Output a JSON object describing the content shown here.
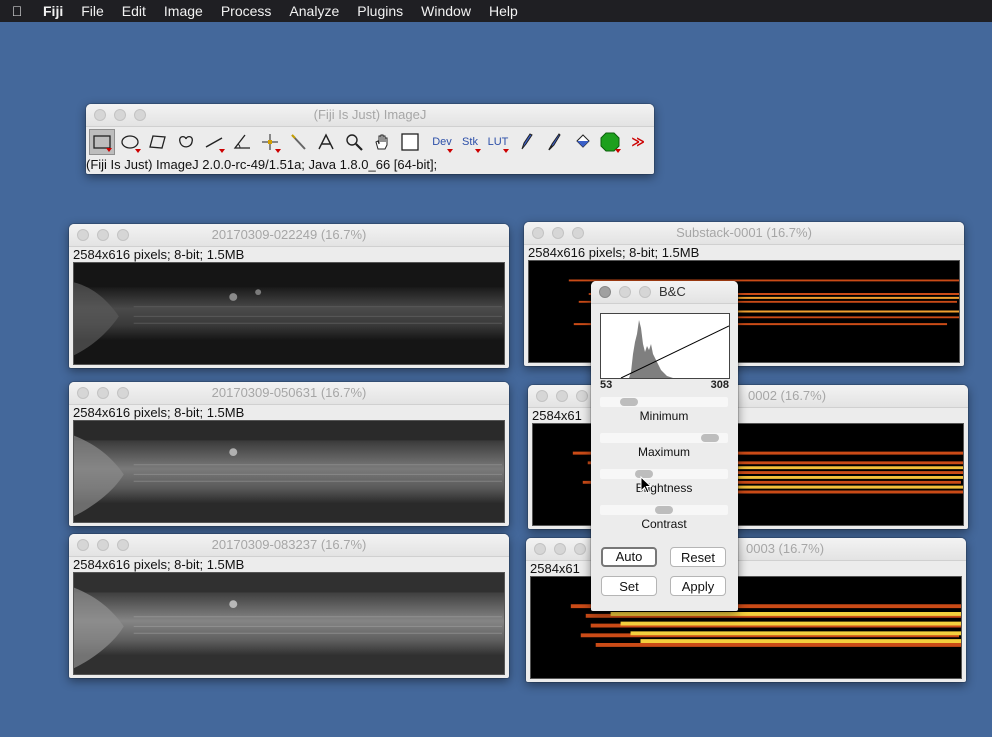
{
  "menubar": {
    "app": "Fiji",
    "items": [
      "File",
      "Edit",
      "Image",
      "Process",
      "Analyze",
      "Plugins",
      "Window",
      "Help"
    ]
  },
  "imagej": {
    "title": "(Fiji Is Just) ImageJ",
    "status": "(Fiji Is Just) ImageJ 2.0.0-rc-49/1.51a; Java 1.8.0_66 [64-bit];",
    "tools": [
      "rectangle-icon",
      "oval-icon",
      "polygon-icon",
      "freehand-icon",
      "line-icon",
      "angle-icon",
      "point-icon",
      "wand-icon",
      "text-icon",
      "magnifier-icon",
      "hand-icon",
      "dropper-icon"
    ],
    "menu_tools": [
      "Dev",
      "Stk",
      "LUT"
    ],
    "more_label": "≫"
  },
  "windows": [
    {
      "title": "20170309-022249 (16.7%)",
      "info": "2584x616 pixels; 8-bit; 1.5MB"
    },
    {
      "title": "20170309-050631 (16.7%)",
      "info": "2584x616 pixels; 8-bit; 1.5MB"
    },
    {
      "title": "20170309-083237 (16.7%)",
      "info": "2584x616 pixels; 8-bit; 1.5MB"
    },
    {
      "title": "Substack-0001 (16.7%)",
      "info": "2584x616 pixels; 8-bit; 1.5MB"
    },
    {
      "title": "0002 (16.7%)",
      "info": "2584x61"
    },
    {
      "title": "0003 (16.7%)",
      "info": "2584x61"
    }
  ],
  "bc": {
    "title": "B&C",
    "range_min": "53",
    "range_max": "308",
    "minimum_label": "Minimum",
    "maximum_label": "Maximum",
    "brightness_label": "Brightness",
    "contrast_label": "Contrast",
    "minimum_level": 0.18,
    "maximum_level": 0.92,
    "brightness_level": 0.32,
    "contrast_level": 0.5,
    "auto": "Auto",
    "reset": "Reset",
    "set": "Set",
    "apply": "Apply"
  }
}
